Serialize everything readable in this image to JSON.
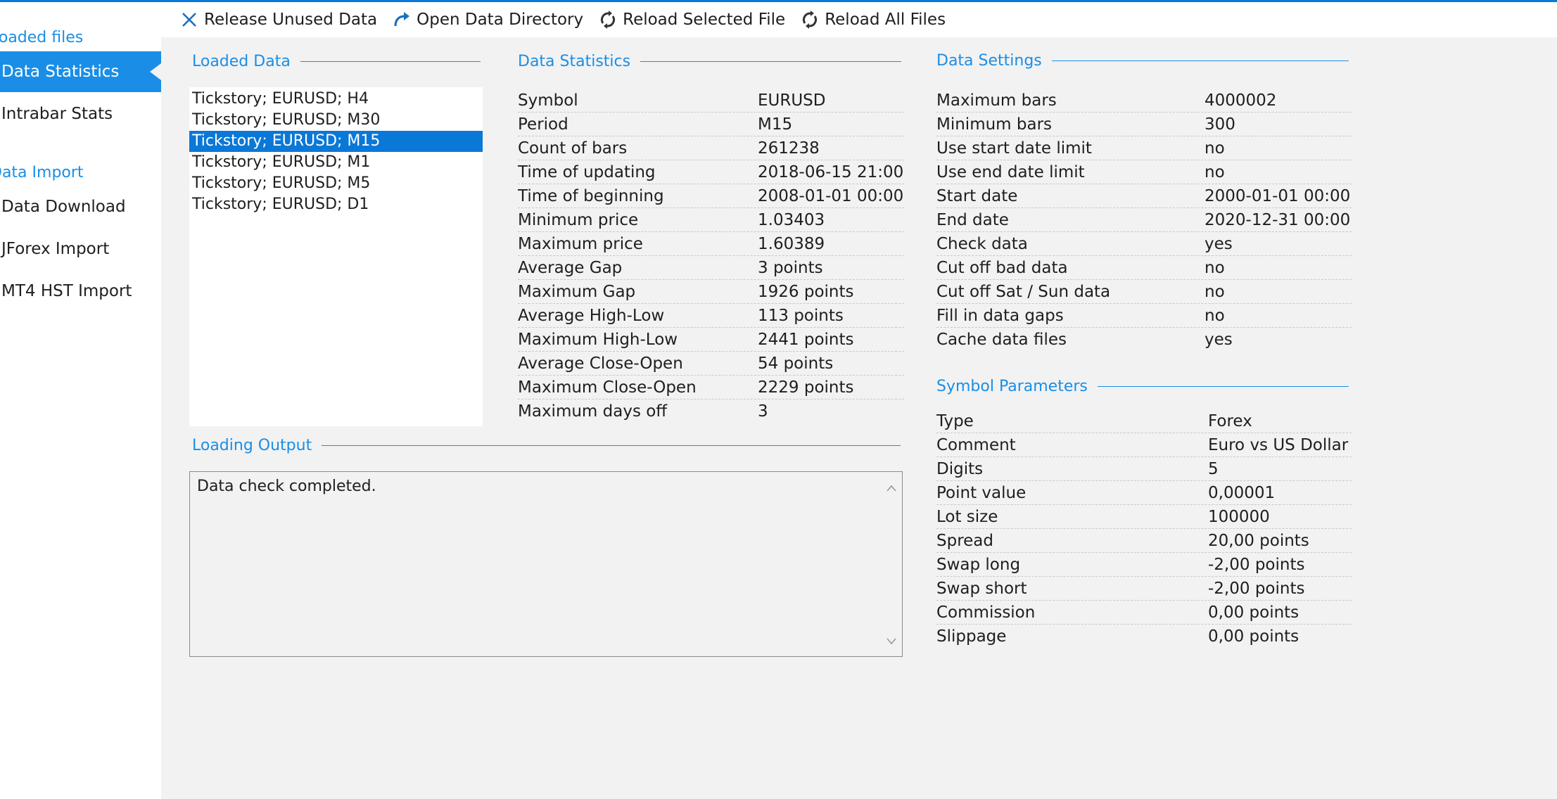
{
  "sidebar": {
    "groups": [
      {
        "label": "Loaded files",
        "items": [
          {
            "label": "Data Statistics",
            "active": true
          },
          {
            "label": "Intrabar Stats",
            "active": false
          }
        ]
      },
      {
        "label": "Data Import",
        "items": [
          {
            "label": "Data Download",
            "active": false
          },
          {
            "label": "JForex Import",
            "active": false
          },
          {
            "label": "MT4 HST Import",
            "active": false
          }
        ]
      }
    ]
  },
  "toolbar": {
    "release_label": "Release Unused Data",
    "open_dir_label": "Open Data Directory",
    "reload_selected_label": "Reload Selected File",
    "reload_all_label": "Reload All Files"
  },
  "loaded_data": {
    "title": "Loaded Data",
    "items": [
      "Tickstory; EURUSD; H4",
      "Tickstory; EURUSD; M30",
      "Tickstory; EURUSD; M15",
      "Tickstory; EURUSD; M1",
      "Tickstory; EURUSD; M5",
      "Tickstory; EURUSD; D1"
    ],
    "selected_index": 2
  },
  "data_statistics": {
    "title": "Data Statistics",
    "rows": [
      {
        "key": "Symbol",
        "value": "EURUSD"
      },
      {
        "key": "Period",
        "value": "M15"
      },
      {
        "key": "Count of bars",
        "value": "261238"
      },
      {
        "key": "Time of updating",
        "value": "2018-06-15 21:00"
      },
      {
        "key": "Time of beginning",
        "value": "2008-01-01 00:00"
      },
      {
        "key": "Minimum price",
        "value": "1.03403"
      },
      {
        "key": "Maximum price",
        "value": "1.60389"
      },
      {
        "key": "Average Gap",
        "value": "3 points"
      },
      {
        "key": "Maximum Gap",
        "value": "1926 points"
      },
      {
        "key": "Average High-Low",
        "value": "113 points"
      },
      {
        "key": "Maximum High-Low",
        "value": "2441 points"
      },
      {
        "key": "Average Close-Open",
        "value": "54 points"
      },
      {
        "key": "Maximum Close-Open",
        "value": "2229 points"
      },
      {
        "key": "Maximum days off",
        "value": "3"
      }
    ]
  },
  "data_settings": {
    "title": "Data Settings",
    "rows": [
      {
        "key": "Maximum bars",
        "value": "4000002"
      },
      {
        "key": "Minimum bars",
        "value": "300"
      },
      {
        "key": "Use start date limit",
        "value": "no"
      },
      {
        "key": "Use end date limit",
        "value": "no"
      },
      {
        "key": "Start date",
        "value": "2000-01-01 00:00"
      },
      {
        "key": "End date",
        "value": "2020-12-31 00:00"
      },
      {
        "key": "Check data",
        "value": "yes"
      },
      {
        "key": "Cut off bad data",
        "value": "no"
      },
      {
        "key": "Cut off Sat / Sun data",
        "value": "no"
      },
      {
        "key": "Fill in data gaps",
        "value": "no"
      },
      {
        "key": "Cache data files",
        "value": "yes"
      }
    ]
  },
  "symbol_parameters": {
    "title": "Symbol Parameters",
    "rows": [
      {
        "key": "Type",
        "value": "Forex"
      },
      {
        "key": "Comment",
        "value": "Euro vs US Dollar"
      },
      {
        "key": "Digits",
        "value": "5"
      },
      {
        "key": "Point value",
        "value": "0,00001"
      },
      {
        "key": "Lot size",
        "value": "100000"
      },
      {
        "key": "Spread",
        "value": "20,00 points"
      },
      {
        "key": "Swap long",
        "value": "-2,00 points"
      },
      {
        "key": "Swap short",
        "value": "-2,00 points"
      },
      {
        "key": "Commission",
        "value": "0,00 points"
      },
      {
        "key": "Slippage",
        "value": "0,00 points"
      }
    ]
  },
  "loading_output": {
    "title": "Loading Output",
    "text": "Data check completed."
  },
  "colors": {
    "accent": "#1a8ee6",
    "selection": "#0a78d7"
  }
}
